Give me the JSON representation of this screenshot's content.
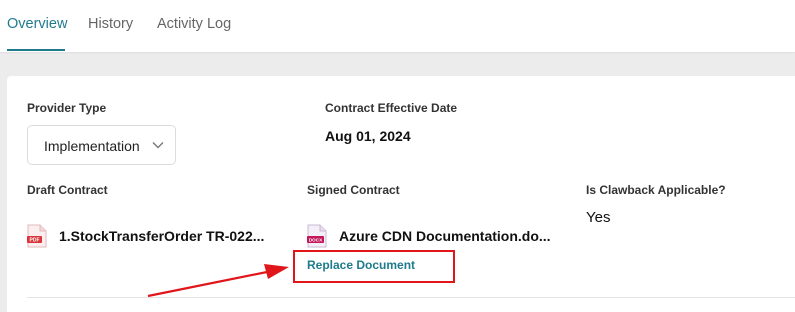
{
  "tabs": [
    {
      "label": "Overview",
      "active": true
    },
    {
      "label": "History",
      "active": false
    },
    {
      "label": "Activity Log",
      "active": false
    }
  ],
  "fields": {
    "provider_type": {
      "label": "Provider Type",
      "value": "Implementation"
    },
    "contract_effective_date": {
      "label": "Contract Effective Date",
      "value": "Aug 01, 2024"
    },
    "draft_contract": {
      "label": "Draft Contract",
      "file_name": "1.StockTransferOrder TR-022...",
      "icon": "pdf-file-icon",
      "icon_text": "PDF"
    },
    "signed_contract": {
      "label": "Signed Contract",
      "file_name": "Azure CDN Documentation.do...",
      "icon": "doc-file-icon",
      "icon_text": "DOCX"
    },
    "is_clawback_applicable": {
      "label": "Is Clawback Applicable?",
      "value": "Yes"
    }
  },
  "replace_document_label": "Replace Document",
  "colors": {
    "accent": "#1f7b8c",
    "annotation": "#e0161b",
    "pdf_red": "#d9343b"
  }
}
